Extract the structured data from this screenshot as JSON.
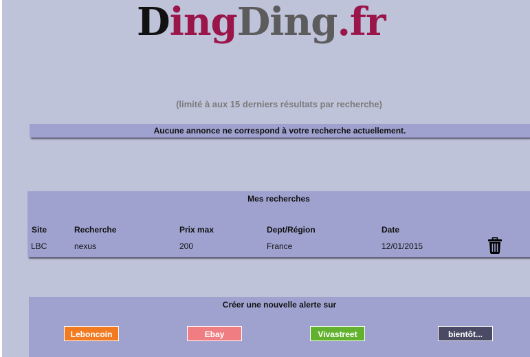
{
  "logo": {
    "part1": "D",
    "part2": "ing",
    "part3": "Ding",
    "part4": ".fr"
  },
  "limit_note": "(limité à aux 15 derniers résultats par recherche)",
  "results": {
    "empty_message": "Aucune annonce ne correspond à votre recherche actuellement."
  },
  "searches": {
    "title": "Mes recherches",
    "headers": {
      "site": "Site",
      "query": "Recherche",
      "max_price": "Prix max",
      "region": "Dept/Région",
      "date": "Date"
    },
    "rows": [
      {
        "site": "LBC",
        "query": "nexus",
        "max_price": "200",
        "region": "France",
        "date": "12/01/2015",
        "delete_icon": "trash-icon"
      }
    ]
  },
  "new_alert": {
    "title": "Créer une nouvelle alerte sur",
    "buttons": {
      "leboncoin": "Leboncoin",
      "ebay": "Ebay",
      "vivastreet": "Vivastreet",
      "soon": "bientôt..."
    }
  },
  "colors": {
    "background": "#bfc3da",
    "panel": "#9fa2cf",
    "logo_crimson": "#9a1549",
    "logo_gray": "#5c5c5c",
    "leboncoin": "#f27a21",
    "ebay": "#f07d82",
    "vivastreet": "#62b22f",
    "soon": "#4a4a64"
  }
}
